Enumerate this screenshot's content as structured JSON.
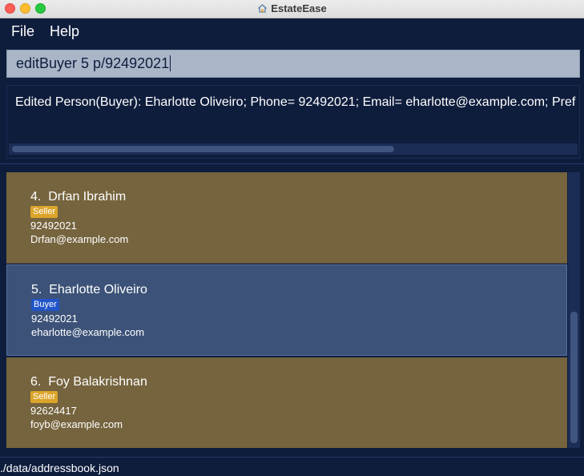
{
  "window": {
    "title": "EstateEase"
  },
  "menu": {
    "file": "File",
    "help": "Help"
  },
  "command": {
    "value": "editBuyer 5 p/92492021"
  },
  "result": {
    "text": "Edited Person(Buyer): Eharlotte Oliveiro; Phone= 92492021; Email= eharlotte@example.com; Pref"
  },
  "persons": [
    {
      "index": "4.",
      "name": "Drfan Ibrahim",
      "tag": "Seller",
      "phone": "92492021",
      "email": "Drfan@example.com"
    },
    {
      "index": "5.",
      "name": "Eharlotte Oliveiro",
      "tag": "Buyer",
      "phone": "92492021",
      "email": "eharlotte@example.com"
    },
    {
      "index": "6.",
      "name": "Foy Balakrishnan",
      "tag": "Seller",
      "phone": "92624417",
      "email": "foyb@example.com"
    }
  ],
  "status": {
    "file_path": "./data/addressbook.json"
  },
  "colors": {
    "background": "#0f1d3d",
    "seller_card": "#75643e",
    "buyer_card": "#3c5278",
    "seller_tag": "#dba42a",
    "buyer_tag": "#2255c9"
  }
}
